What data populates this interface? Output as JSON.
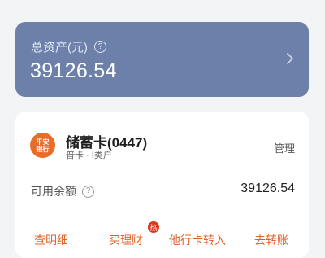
{
  "assets": {
    "label": "总资产(元)",
    "help_glyph": "?",
    "amount": "39126.54"
  },
  "account": {
    "logo_text": "平安银行",
    "card_name": "储蓄卡(0447)",
    "card_type": "普卡 · I类户",
    "manage_label": "管理",
    "balance_label": "可用余额",
    "balance_help_glyph": "?",
    "balance_value": "39126.54"
  },
  "actions": [
    {
      "label": "查明细"
    },
    {
      "label": "买理财",
      "badge": "热"
    },
    {
      "label": "他行卡转入"
    },
    {
      "label": "去转账"
    }
  ],
  "colors": {
    "asset_card_bg": "#6c80aa",
    "bank_logo": "#ec6a2a",
    "hot_badge": "#e2351d",
    "action_text": "#e0622b"
  }
}
